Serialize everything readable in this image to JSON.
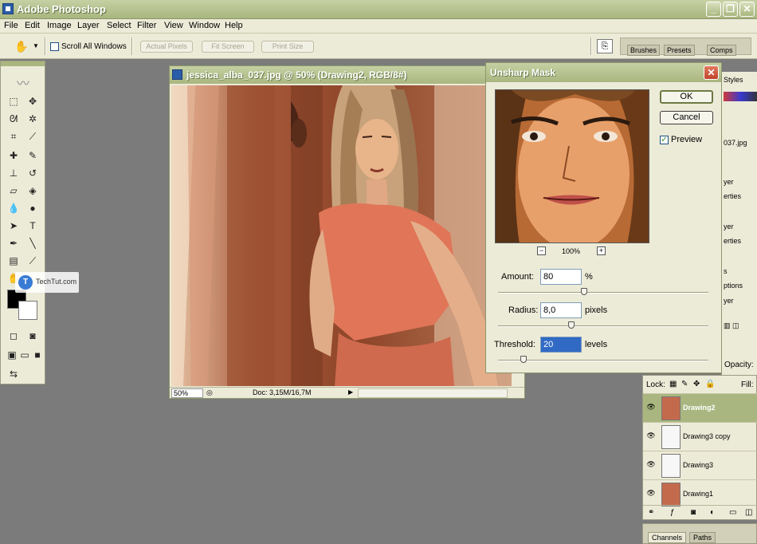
{
  "window": {
    "title": "Adobe Photoshop"
  },
  "menu": [
    "File",
    "Edit",
    "Image",
    "Layer",
    "Select",
    "Filter",
    "View",
    "Window",
    "Help"
  ],
  "options": {
    "scroll_all": "Scroll All Windows",
    "actual_pixels": "Actual Pixels",
    "fit_screen": "Fit Screen",
    "print_size": "Print Size"
  },
  "palette_well": {
    "tabs": [
      "Brushes",
      "Presets",
      "Comps"
    ]
  },
  "document": {
    "title": "jessica_alba_037.jpg @ 50% (Drawing2, RGB/8#)",
    "zoom": "50%",
    "doc_info": "Doc: 3,15M/16,7M"
  },
  "watermark": {
    "text": "TechTut.com"
  },
  "dialog": {
    "title": "Unsharp Mask",
    "ok": "OK",
    "cancel": "Cancel",
    "preview_label": "Preview",
    "preview_checked": true,
    "zoom": "100%",
    "amount": {
      "label": "Amount:",
      "value": "80",
      "unit": "%",
      "level": 0.41
    },
    "radius": {
      "label": "Radius:",
      "value": "8,0",
      "unit": "pixels",
      "level": 0.35
    },
    "threshold": {
      "label": "Threshold:",
      "value": "20",
      "unit": "levels",
      "level": 0.12
    }
  },
  "right_panels": {
    "styles_tab": "Styles",
    "history_items": [
      "037.jpg",
      "yer",
      "erties",
      "yer",
      "erties",
      "s",
      "ptions",
      "yer"
    ]
  },
  "layers": {
    "opacity_label": "Opacity:",
    "lock_label": "Lock:",
    "fill_label": "Fill:",
    "items": [
      {
        "name": "Drawing2",
        "active": true
      },
      {
        "name": "Drawing3 copy",
        "active": false
      },
      {
        "name": "Drawing3",
        "active": false
      },
      {
        "name": "Drawing1",
        "active": false
      }
    ]
  },
  "bottom_tabs": [
    "Channels",
    "Paths"
  ],
  "colors": {
    "title_green": "#a9b67f",
    "panel_bg": "#ecebd8",
    "workspace": "#7b7b7b"
  }
}
